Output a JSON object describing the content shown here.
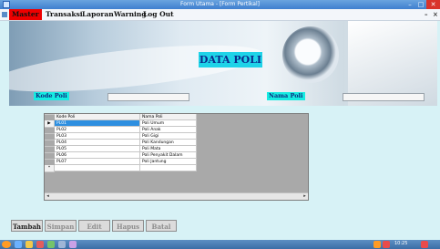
{
  "window": {
    "title": "Form Utama - [Form Pertikal]",
    "controls": {
      "minimize": "–",
      "maximize": "□",
      "close": "✕"
    }
  },
  "menubar": {
    "items": [
      "Master",
      "Transaksi",
      "Laporan",
      "Warning",
      "Log Out"
    ],
    "mdi_controls": {
      "minimize": "–",
      "close": "×"
    }
  },
  "header": {
    "title": "DATA POLI",
    "kode_label": "Kode Poli",
    "kode_value": "",
    "nama_label": "Nama Poli",
    "nama_value": ""
  },
  "grid": {
    "columns": [
      "Kode Poli",
      "Nama Poli"
    ],
    "rows": [
      {
        "marker": "▶",
        "kode": "PL01",
        "nama": "Poli Umum",
        "selected": true
      },
      {
        "marker": "",
        "kode": "PL02",
        "nama": "Poli Anak",
        "selected": false
      },
      {
        "marker": "",
        "kode": "PL03",
        "nama": "Poli Gigi",
        "selected": false
      },
      {
        "marker": "",
        "kode": "PL04",
        "nama": "Poli Kandungan",
        "selected": false
      },
      {
        "marker": "",
        "kode": "PL05",
        "nama": "Poli Mata",
        "selected": false
      },
      {
        "marker": "",
        "kode": "PL06",
        "nama": "Poli Penyakit Dalam",
        "selected": false
      },
      {
        "marker": "",
        "kode": "PL07",
        "nama": "Poli Jantung",
        "selected": false
      },
      {
        "marker": "*",
        "kode": "",
        "nama": "",
        "selected": false
      }
    ],
    "scroll": {
      "left": "◂",
      "right": "▸"
    }
  },
  "buttons": {
    "tambah": "Tambah",
    "simpan": "Simpan",
    "edit": "Edit",
    "hapus": "Hapus",
    "batal": "Batal"
  },
  "taskbar": {
    "clock": "10:25"
  }
}
